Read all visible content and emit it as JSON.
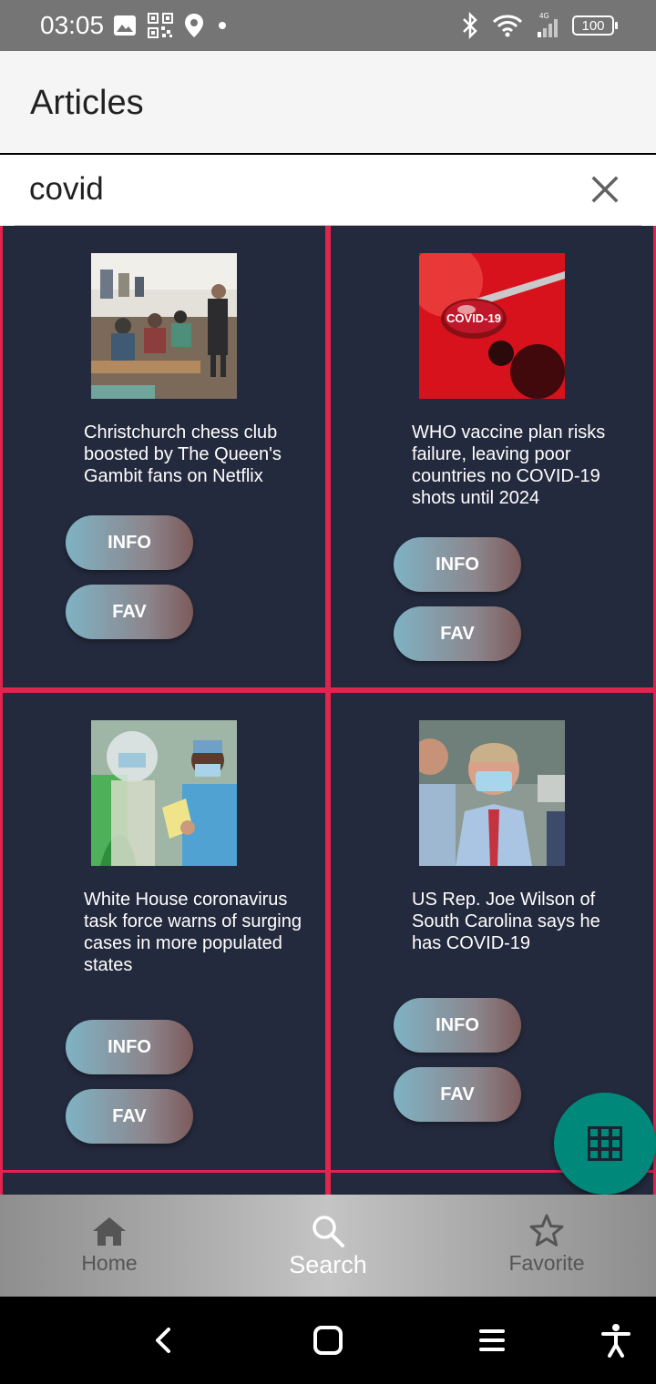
{
  "status_bar": {
    "time": "03:05",
    "battery": "100",
    "network": "4G"
  },
  "app_bar": {
    "title": "Articles"
  },
  "search": {
    "value": "covid",
    "placeholder": ""
  },
  "articles": [
    {
      "title": "Christchurch chess club boosted by The Queen's Gambit fans on Netflix",
      "info_label": "INFO",
      "fav_label": "FAV"
    },
    {
      "title": "WHO vaccine plan risks failure, leaving poor countries no COVID-19 shots until 2024",
      "info_label": "INFO",
      "fav_label": "FAV",
      "image_text": "COVID-19"
    },
    {
      "title": "White House coronavirus task force warns of surging cases in more populated states",
      "info_label": "INFO",
      "fav_label": "FAV"
    },
    {
      "title": "US Rep. Joe Wilson of South Carolina says he has COVID-19",
      "info_label": "INFO",
      "fav_label": "FAV"
    }
  ],
  "fab": {
    "icon": "grid-view-icon"
  },
  "bottom_nav": {
    "items": [
      {
        "label": "Home",
        "icon": "home-icon"
      },
      {
        "label": "Search",
        "icon": "search-icon",
        "active": true
      },
      {
        "label": "Favorite",
        "icon": "star-icon"
      }
    ]
  },
  "colors": {
    "card_background": "#242a3d",
    "card_border": "#e0244d",
    "fab": "#00897b",
    "status_bar": "#757575"
  }
}
